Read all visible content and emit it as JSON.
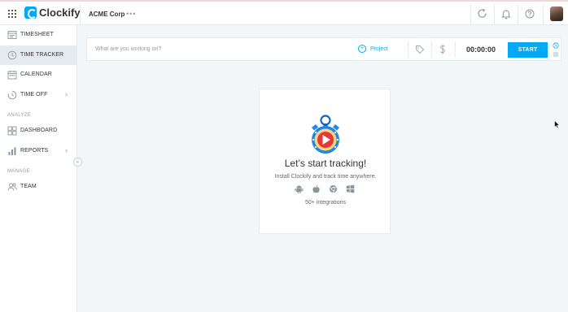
{
  "header": {
    "app_name": "Clockify",
    "workspace": "ACME Corp",
    "more_label": "•••"
  },
  "sidebar": {
    "items": [
      {
        "label": "TIMESHEET",
        "icon": "timesheet-icon"
      },
      {
        "label": "TIME TRACKER",
        "icon": "clock-icon",
        "active": true
      },
      {
        "label": "CALENDAR",
        "icon": "calendar-icon"
      },
      {
        "label": "TIME OFF",
        "icon": "time-off-icon",
        "has_submenu": true
      },
      {
        "label": "DASHBOARD",
        "icon": "dashboard-icon"
      },
      {
        "label": "REPORTS",
        "icon": "reports-icon",
        "has_submenu": true
      },
      {
        "label": "TEAM",
        "icon": "team-icon"
      }
    ],
    "sections": {
      "analyze": "ANALYZE",
      "manage": "MANAGE"
    },
    "chevron": "›",
    "collapse": "«"
  },
  "tracker": {
    "placeholder": "What are you working on?",
    "project_label": "Project",
    "timer": "00:00:00",
    "start_label": "START"
  },
  "empty_state": {
    "title": "Let’s start tracking!",
    "subtitle": "Install Clockify and track time anywhere.",
    "integrations": "50+ integrations",
    "platforms": [
      "android-icon",
      "apple-icon",
      "chrome-icon",
      "windows-icon"
    ]
  },
  "colors": {
    "accent": "#03a9f4",
    "sidebar_active": "#e4eaee",
    "background": "#f2f6f8"
  }
}
